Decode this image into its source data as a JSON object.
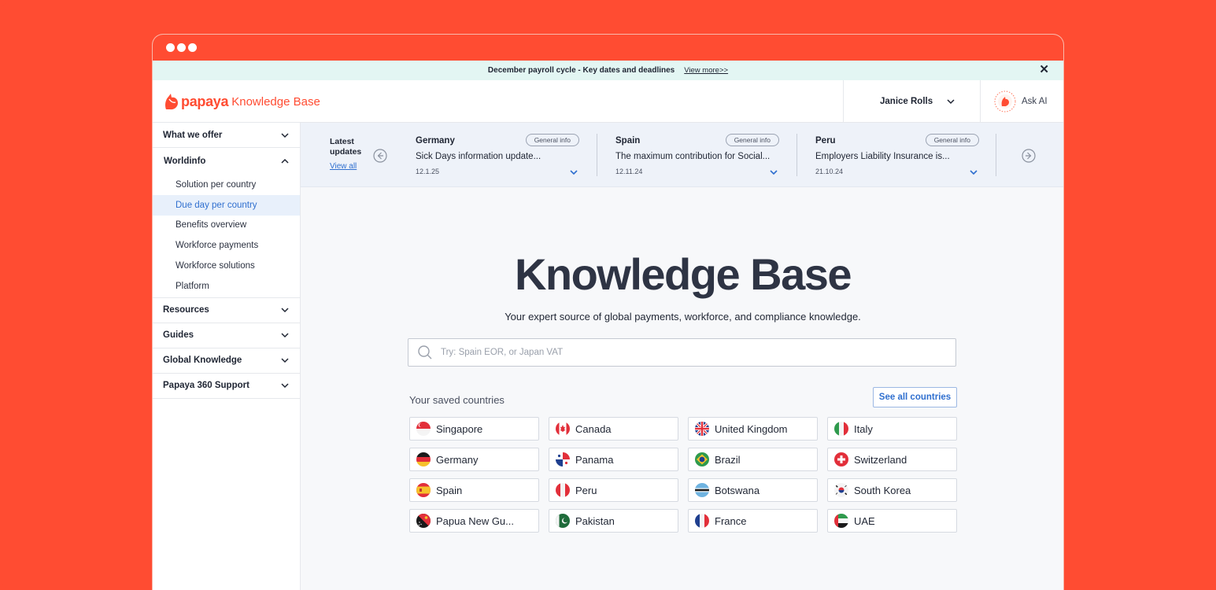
{
  "announcement": {
    "text": "December payroll cycle - Key dates and deadlines",
    "link": "View more>>",
    "close": "✕"
  },
  "header": {
    "brand": "papaya",
    "product": "Knowledge Base",
    "user_name": "Janice Rolls",
    "ask_ai": "Ask AI"
  },
  "sidebar": {
    "items": [
      {
        "label": "What we offer"
      },
      {
        "label": "Worldinfo",
        "sub": [
          "Solution per country",
          "Due day per country",
          "Benefits overview",
          "Workforce payments",
          "Workforce solutions",
          "Platform"
        ]
      },
      {
        "label": "Resources"
      },
      {
        "label": "Guides"
      },
      {
        "label": "Global Knowledge"
      },
      {
        "label": "Papaya 360 Support"
      }
    ]
  },
  "updates": {
    "title_line1": "Latest",
    "title_line2": "updates",
    "view_all": "View all",
    "cards": [
      {
        "country": "Germany",
        "tag": "General info",
        "text": "Sick Days information update...",
        "date": "12.1.25"
      },
      {
        "country": "Spain",
        "tag": "General info",
        "text": "The maximum contribution for Social...",
        "date": "12.11.24"
      },
      {
        "country": "Peru",
        "tag": "General info",
        "text": "Employers Liability Insurance is...",
        "date": "21.10.24"
      }
    ]
  },
  "hero": {
    "title": "Knowledge Base",
    "subtitle": "Your expert source of global payments, workforce, and compliance knowledge."
  },
  "search": {
    "placeholder": "Try: Spain EOR, or Japan VAT"
  },
  "saved": {
    "label": "Your saved countries",
    "see_all": "See all countries",
    "countries": [
      "Singapore",
      "Canada",
      "United Kingdom",
      "Italy",
      "Germany",
      "Panama",
      "Brazil",
      "Switzerland",
      "Spain",
      "Peru",
      "Botswana",
      "South Korea",
      "Papua New Gu...",
      "Pakistan",
      "France",
      "UAE"
    ]
  },
  "colors": {
    "brand": "#ff4c32",
    "link": "#2f6fcf",
    "active_bg": "#e8f0fb"
  }
}
